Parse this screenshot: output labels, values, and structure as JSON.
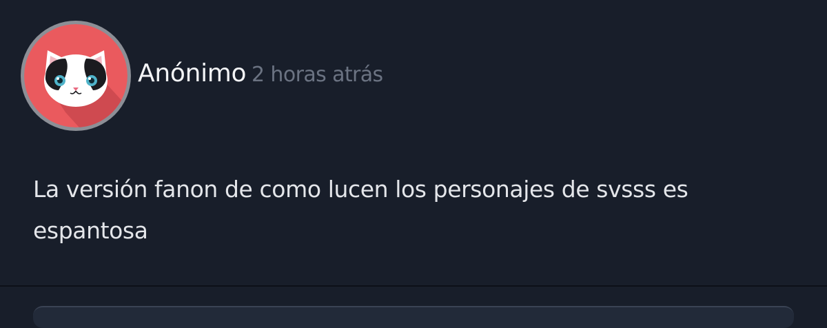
{
  "post": {
    "author": "Anónimo",
    "timestamp": "2 horas atrás",
    "body": "La versión fanon de como lucen los personajes de svsss es espantosa"
  },
  "avatar": {
    "icon": "cat-face-icon",
    "background": "#ea5a5e",
    "ring": "#8c8f96"
  },
  "colors": {
    "page_background": "#181e2a",
    "author_text": "#f3f4f6",
    "timestamp_text": "#6b7382",
    "body_text": "#e4e6ea"
  }
}
